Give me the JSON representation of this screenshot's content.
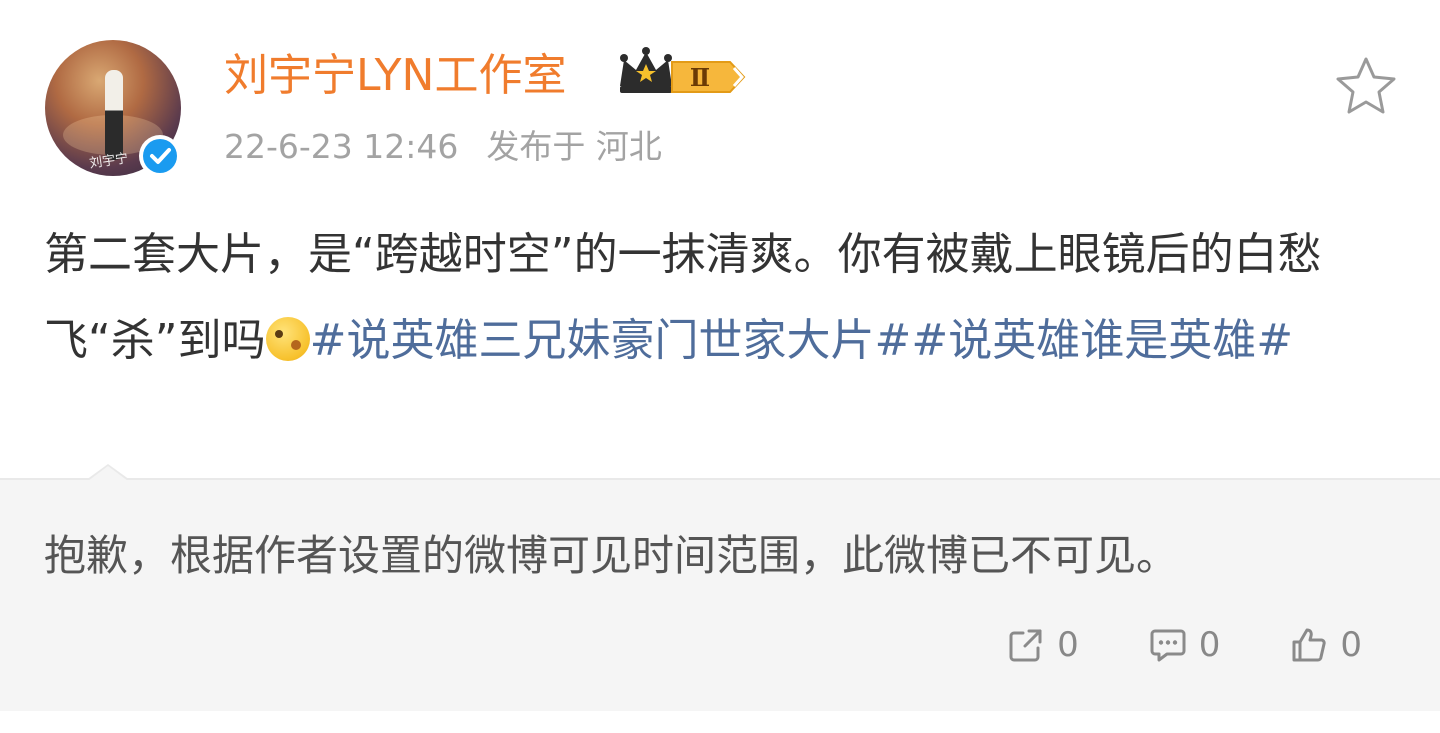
{
  "post": {
    "author": "刘宇宁LYN工作室",
    "avatar_signature": "刘宇宁",
    "badge_level": "Ⅱ",
    "timestamp": "22-6-23 12:46",
    "location": "发布于 河北",
    "text_1": "第二套大片，是“跨越时空”的一抹清爽。你有被戴上眼镜后的白愁飞“杀”到吗",
    "emoji_icon": "thinking-face-emoji",
    "hashtag_1": "#说英雄三兄妹豪门世家大片#",
    "hashtag_2": "#说英雄谁是英雄#"
  },
  "repost": {
    "unavailable_text": "抱歉，根据作者设置的微博可见时间范围，此微博已不可见。",
    "actions": {
      "share_count": "0",
      "comment_count": "0",
      "like_count": "0"
    }
  },
  "colors": {
    "username": "#f07c2d",
    "hashtag": "#4f6d9b",
    "meta": "#a3a3a3",
    "verified": "#1a9bf0",
    "repost_bg": "#f5f5f5"
  }
}
